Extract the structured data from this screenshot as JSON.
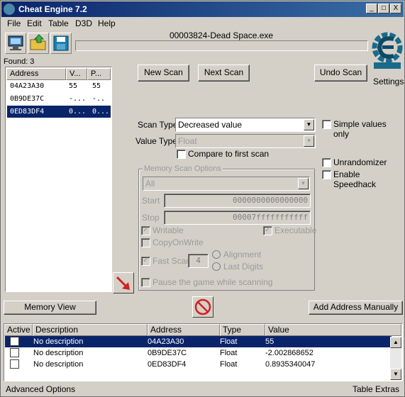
{
  "window": {
    "title": "Cheat Engine 7.2",
    "min": "_",
    "max": "□",
    "close": "X"
  },
  "menu": [
    "File",
    "Edit",
    "Table",
    "D3D",
    "Help"
  ],
  "process_name": "00003824-Dead Space.exe",
  "logo_text": "Cheat Engine",
  "settings_label": "Settings",
  "found_label": "Found: 3",
  "results": {
    "columns": [
      "Address",
      "V...",
      "P..."
    ],
    "rows": [
      {
        "address": "04A23A30",
        "value": "55",
        "previous": "55",
        "selected": false
      },
      {
        "address": "0B9DE37C",
        "value": "-...",
        "previous": "-..",
        "selected": false
      },
      {
        "address": "0ED83DF4",
        "value": "0...",
        "previous": "0...",
        "selected": true
      }
    ]
  },
  "buttons": {
    "new_scan": "New Scan",
    "next_scan": "Next Scan",
    "undo_scan": "Undo Scan",
    "memory_view": "Memory View",
    "add_address": "Add Address Manually"
  },
  "scan": {
    "scan_type_label": "Scan Type",
    "scan_type_value": "Decreased value",
    "value_type_label": "Value Type",
    "value_type_value": "Float",
    "compare_first": "Compare to first scan",
    "simple_values": "Simple values only",
    "unrandomizer": "Unrandomizer",
    "speedhack": "Enable Speedhack"
  },
  "memory_options": {
    "title": "Memory Scan Options",
    "region": "All",
    "start_label": "Start",
    "start_value": "0000000000000000",
    "stop_label": "Stop",
    "stop_value": "00007fffffffffff",
    "writable": "Writable",
    "executable": "Executable",
    "copy_on_write": "CopyOnWrite",
    "fast_scan": "Fast Scan",
    "fast_scan_value": "4",
    "alignment": "Alignment",
    "last_digits": "Last Digits",
    "pause": "Pause the game while scanning"
  },
  "table": {
    "columns": [
      "Active",
      "Description",
      "Address",
      "Type",
      "Value"
    ],
    "rows": [
      {
        "description": "No description",
        "address": "04A23A30",
        "type": "Float",
        "value": "55",
        "selected": true
      },
      {
        "description": "No description",
        "address": "0B9DE37C",
        "type": "Float",
        "value": "-2.002868652",
        "selected": false
      },
      {
        "description": "No description",
        "address": "0ED83DF4",
        "type": "Float",
        "value": "0.8935340047",
        "selected": false
      }
    ]
  },
  "status": {
    "advanced": "Advanced Options",
    "extras": "Table Extras"
  },
  "colors": {
    "title_bar": "#0a246a",
    "selection": "#0a246a",
    "face": "#d4d0c8",
    "arrow_red": "#d42020"
  }
}
